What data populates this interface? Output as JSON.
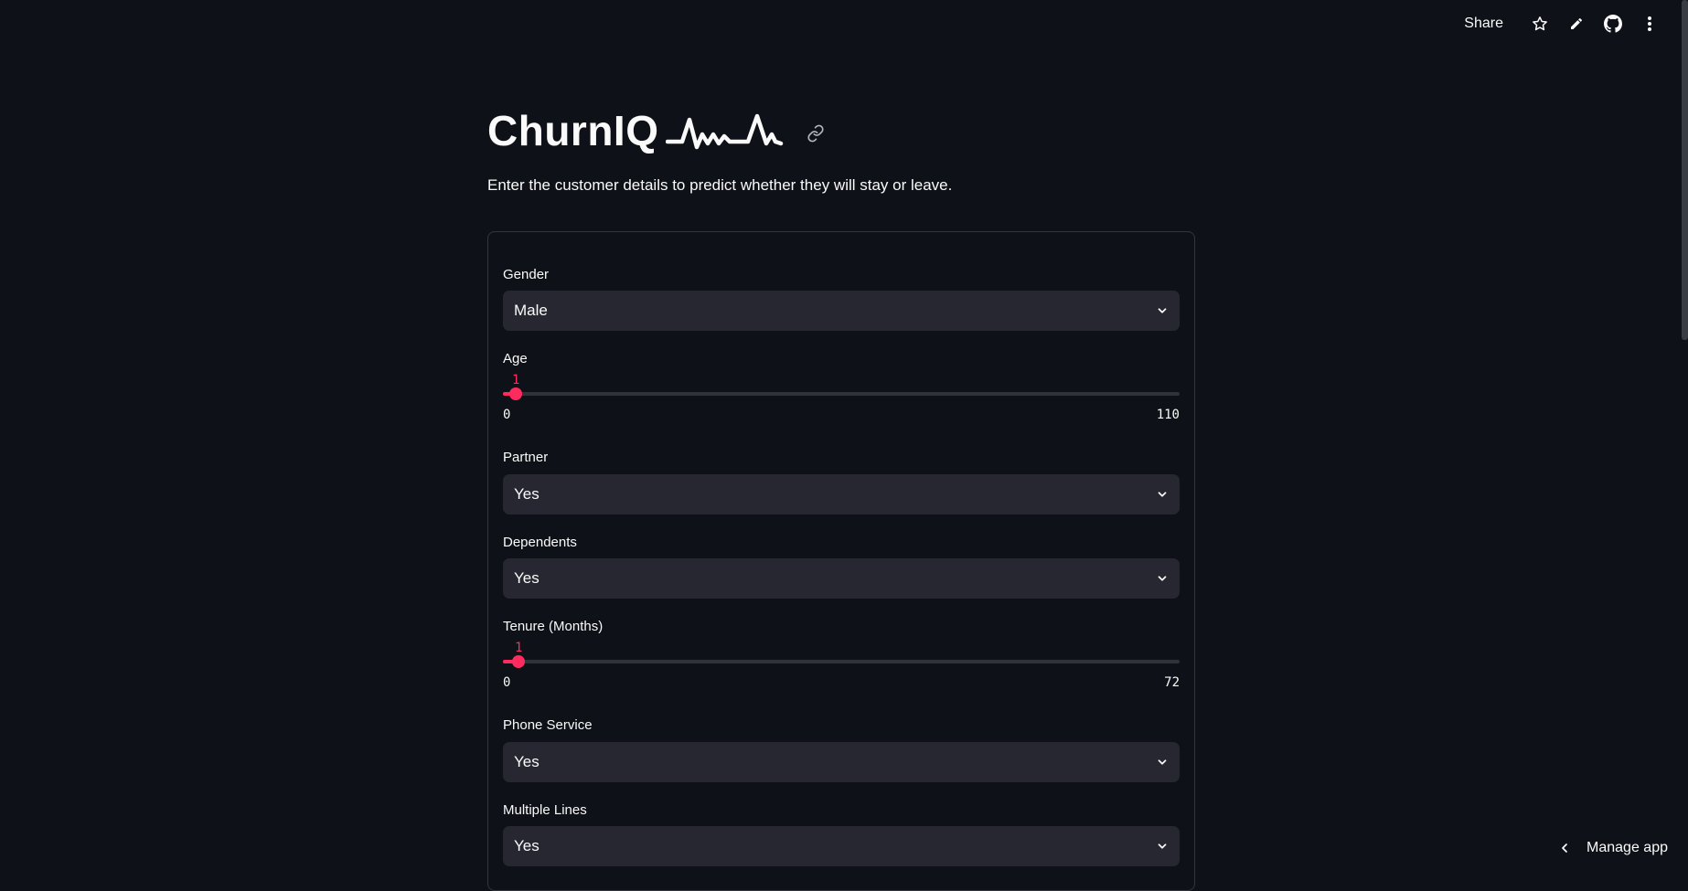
{
  "toolbar": {
    "share_label": "Share",
    "icons": [
      "star-icon",
      "pencil-icon",
      "github-icon",
      "more-vertical-icon"
    ]
  },
  "header": {
    "title": "ChurnIQ",
    "subtitle": "Enter the customer details to predict whether they will stay or leave."
  },
  "form": {
    "gender": {
      "label": "Gender",
      "value": "Male"
    },
    "age": {
      "label": "Age",
      "value": "1",
      "min": "0",
      "max": "110",
      "fraction": 0.009
    },
    "partner": {
      "label": "Partner",
      "value": "Yes"
    },
    "dependents": {
      "label": "Dependents",
      "value": "Yes"
    },
    "tenure": {
      "label": "Tenure (Months)",
      "value": "1",
      "min": "0",
      "max": "72",
      "fraction": 0.014
    },
    "phone_service": {
      "label": "Phone Service",
      "value": "Yes"
    },
    "multiple_lines": {
      "label": "Multiple Lines",
      "value": "Yes"
    }
  },
  "footer": {
    "manage_app_label": "Manage app"
  },
  "colors": {
    "background": "#0e1117",
    "accent": "#ff2b5e",
    "input_bg": "#262730"
  }
}
